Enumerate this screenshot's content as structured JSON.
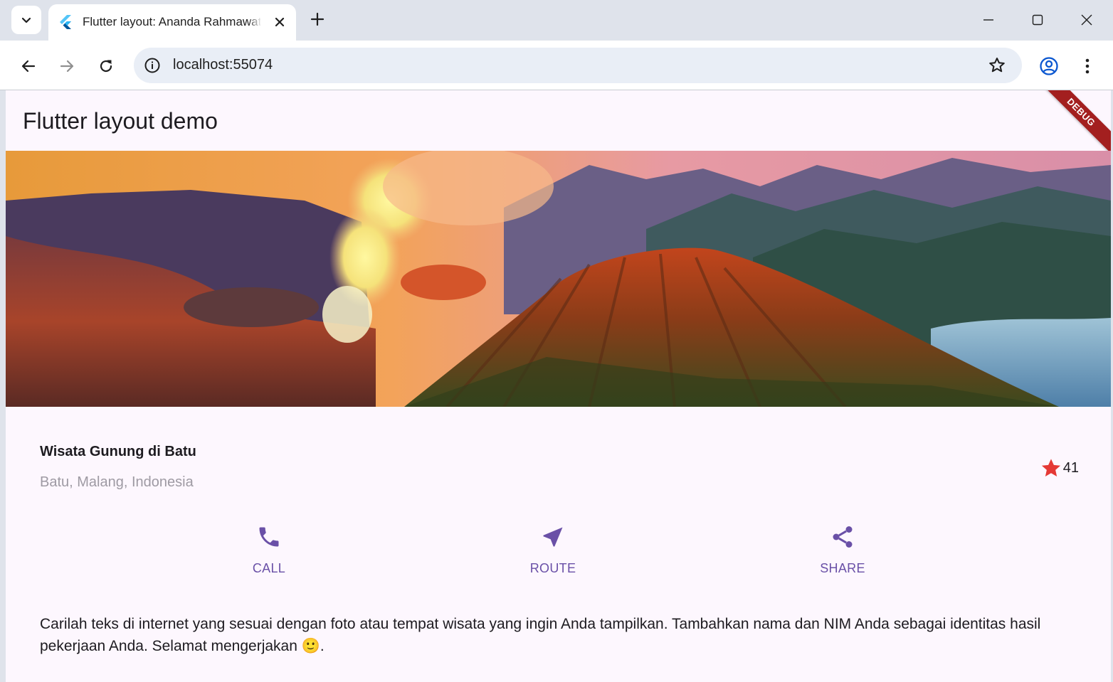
{
  "browser": {
    "tab_title": "Flutter layout: Ananda Rahmawati",
    "url": "localhost:55074"
  },
  "app": {
    "appbar_title": "Flutter layout demo",
    "debug_banner": "DEBUG",
    "place_name": "Wisata Gunung di Batu",
    "location": "Batu, Malang, Indonesia",
    "rating_count": "41",
    "actions": [
      {
        "label": "CALL",
        "icon": "phone-icon"
      },
      {
        "label": "ROUTE",
        "icon": "navigation-icon"
      },
      {
        "label": "SHARE",
        "icon": "share-icon"
      }
    ],
    "description": "Carilah teks di internet yang sesuai dengan foto atau tempat wisata yang ingin Anda tampilkan. Tambahkan nama dan NIM Anda sebagai identitas hasil pekerjaan Anda. Selamat mengerjakan 🙂.",
    "colors": {
      "accent": "#6a50a7",
      "star": "#e53935",
      "background": "#fdf7fe"
    }
  }
}
